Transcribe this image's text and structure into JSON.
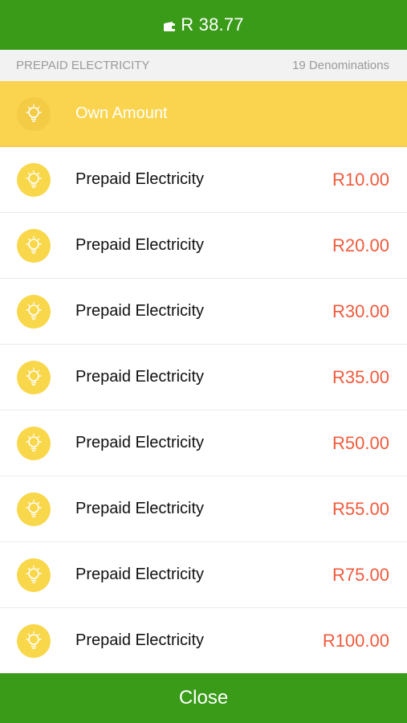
{
  "header": {
    "balance": "R 38.77",
    "wallet_icon": "wallet-icon"
  },
  "subheader": {
    "category": "PREPAID ELECTRICITY",
    "count": "19 Denominations"
  },
  "own_amount": {
    "label": "Own Amount",
    "icon": "lightbulb-icon"
  },
  "items": [
    {
      "label": "Prepaid Electricity",
      "price": "R10.00"
    },
    {
      "label": "Prepaid Electricity",
      "price": "R20.00"
    },
    {
      "label": "Prepaid Electricity",
      "price": "R30.00"
    },
    {
      "label": "Prepaid Electricity",
      "price": "R35.00"
    },
    {
      "label": "Prepaid Electricity",
      "price": "R50.00"
    },
    {
      "label": "Prepaid Electricity",
      "price": "R55.00"
    },
    {
      "label": "Prepaid Electricity",
      "price": "R75.00"
    },
    {
      "label": "Prepaid Electricity",
      "price": "R100.00"
    }
  ],
  "footer": {
    "close_label": "Close"
  },
  "colors": {
    "green": "#3a9b19",
    "yellow": "#fad44e",
    "price_red": "#f05a3b"
  }
}
